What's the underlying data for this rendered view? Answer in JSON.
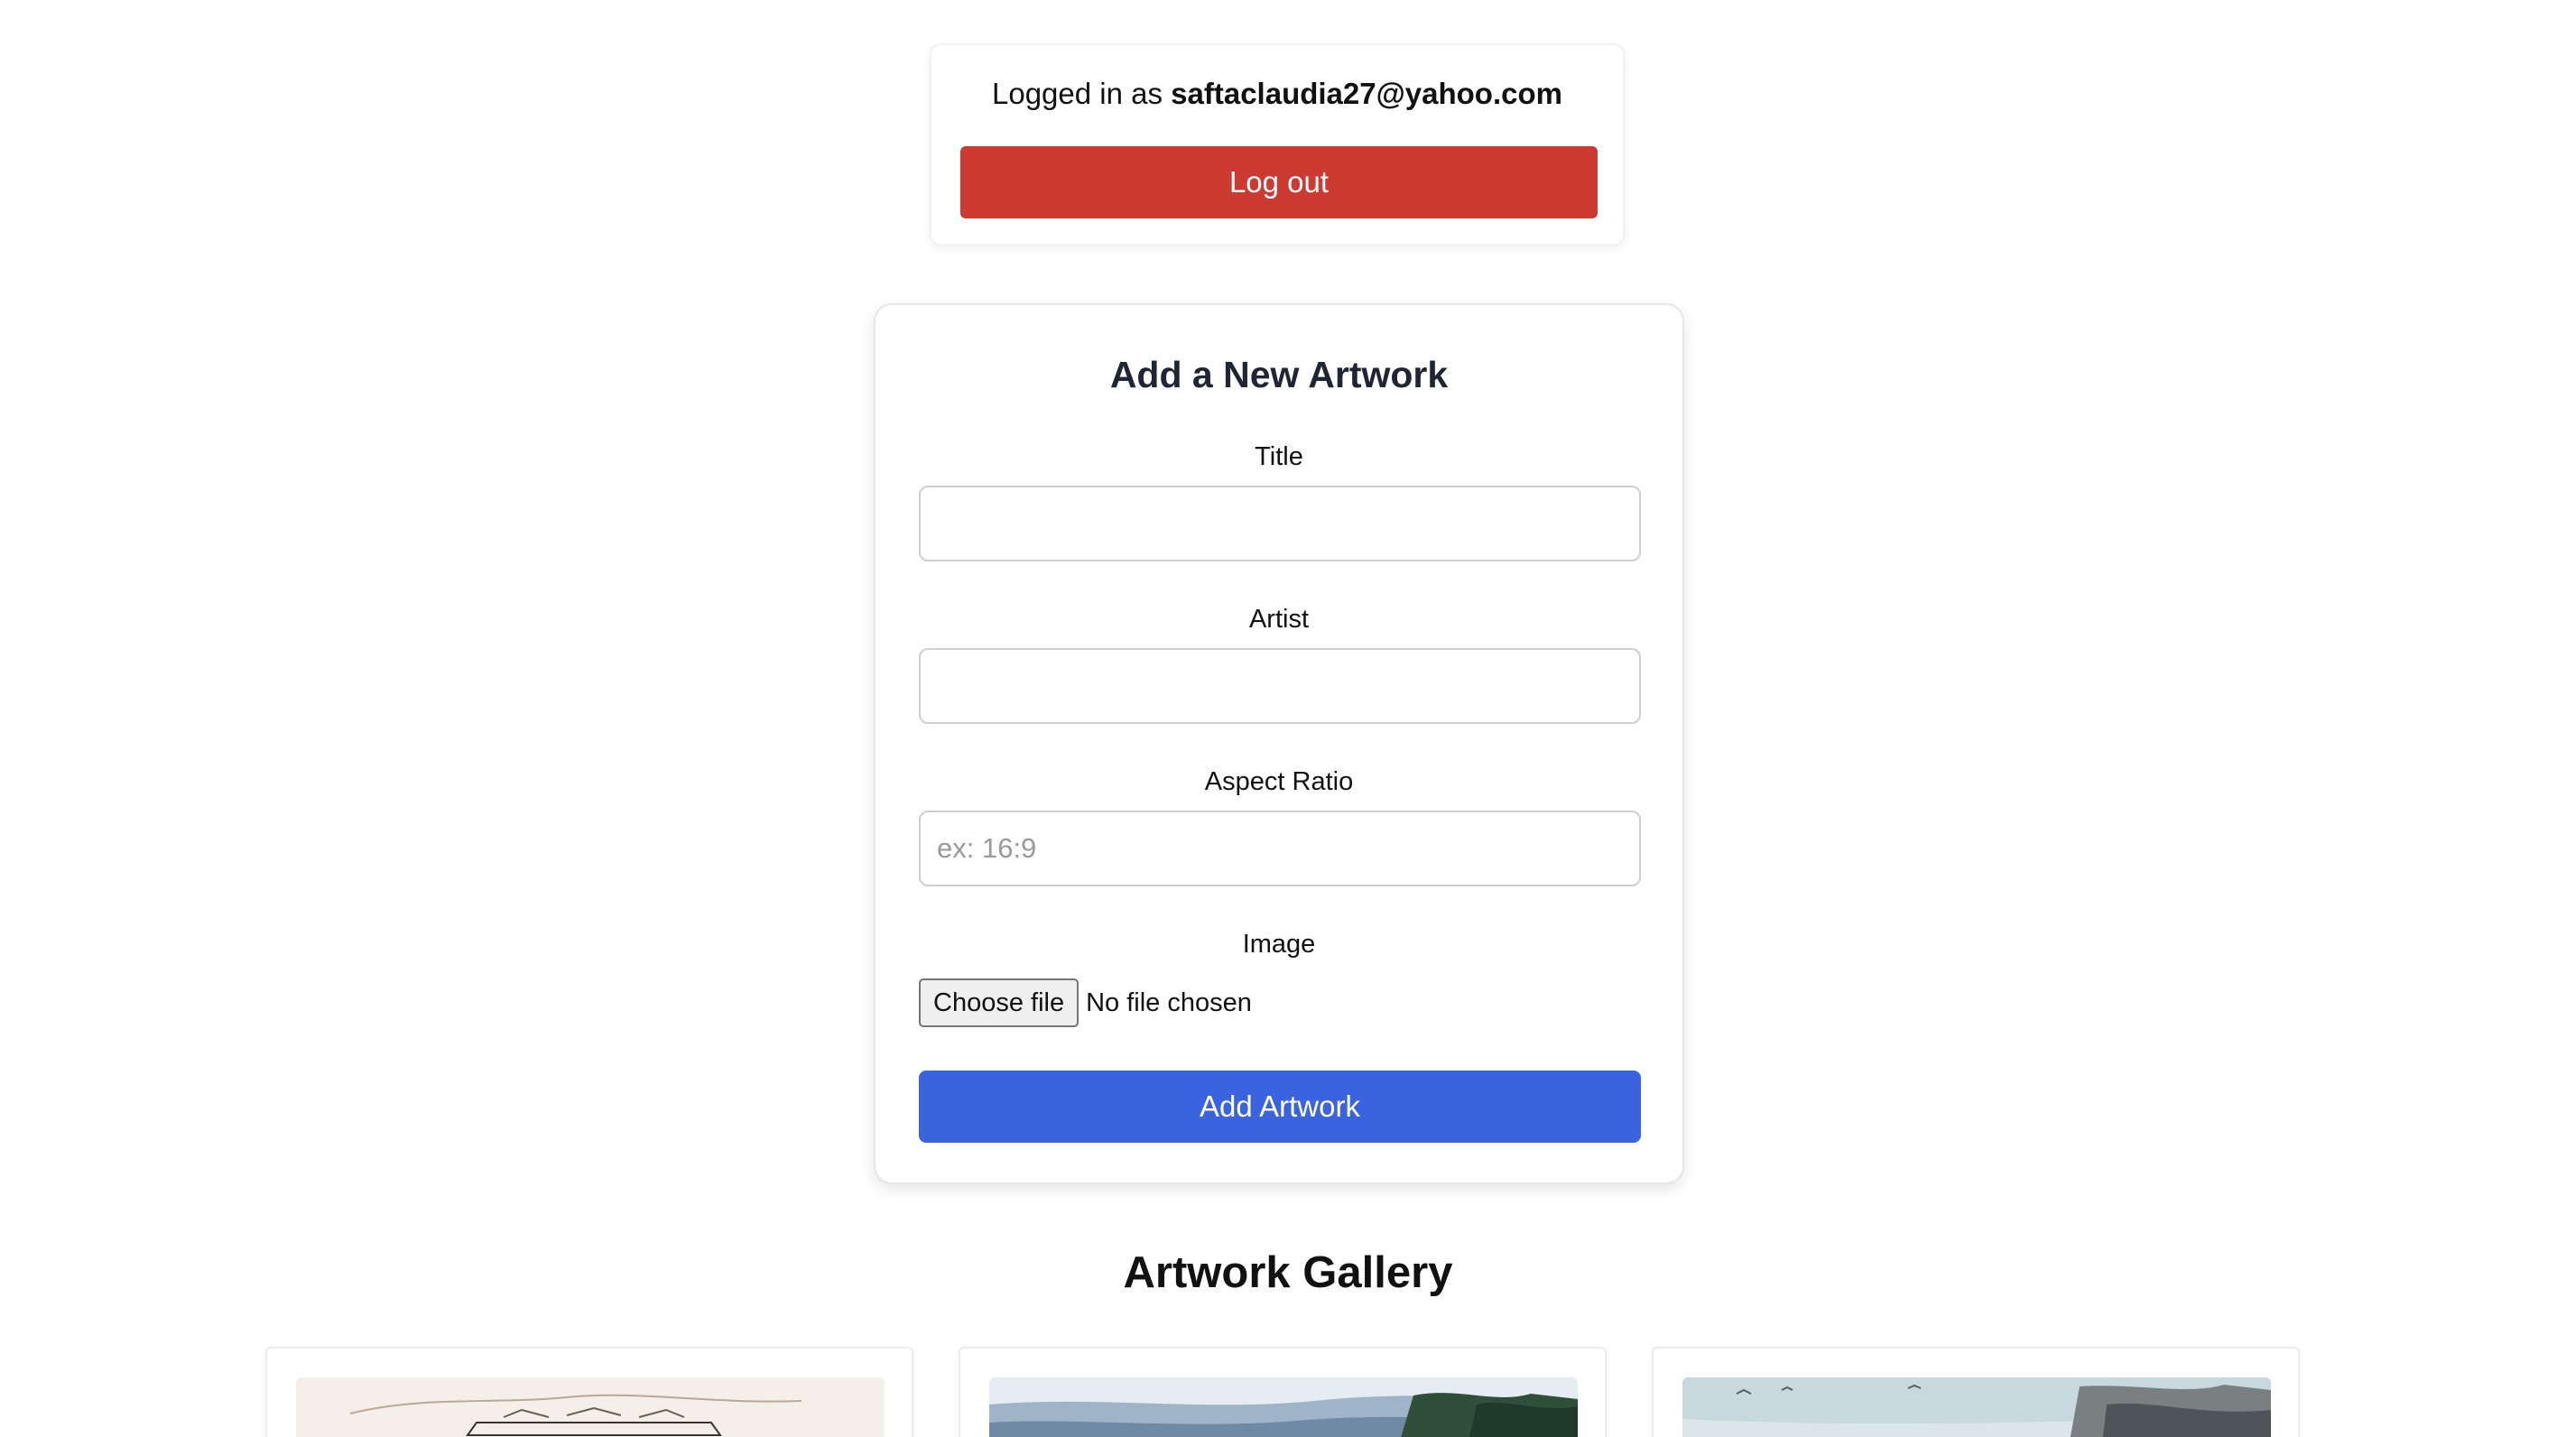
{
  "session": {
    "logged_in_prefix": "Logged in as",
    "email": "saftaclaudia27@yahoo.com",
    "logout_label": "Log out"
  },
  "form": {
    "title": "Add a New Artwork",
    "fields": {
      "title": {
        "label": "Title",
        "value": "",
        "placeholder": ""
      },
      "artist": {
        "label": "Artist",
        "value": "",
        "placeholder": ""
      },
      "aspect_ratio": {
        "label": "Aspect Ratio",
        "value": "",
        "placeholder": "ex: 16:9"
      },
      "image": {
        "label": "Image",
        "button_label": "Choose file",
        "status": "No file chosen"
      }
    },
    "submit_label": "Add Artwork"
  },
  "gallery": {
    "title": "Artwork Gallery"
  },
  "colors": {
    "logout_button": "#cc3a32",
    "submit_button": "#3a63e0",
    "heading": "#1f2533",
    "page_background": "#ffffff"
  }
}
